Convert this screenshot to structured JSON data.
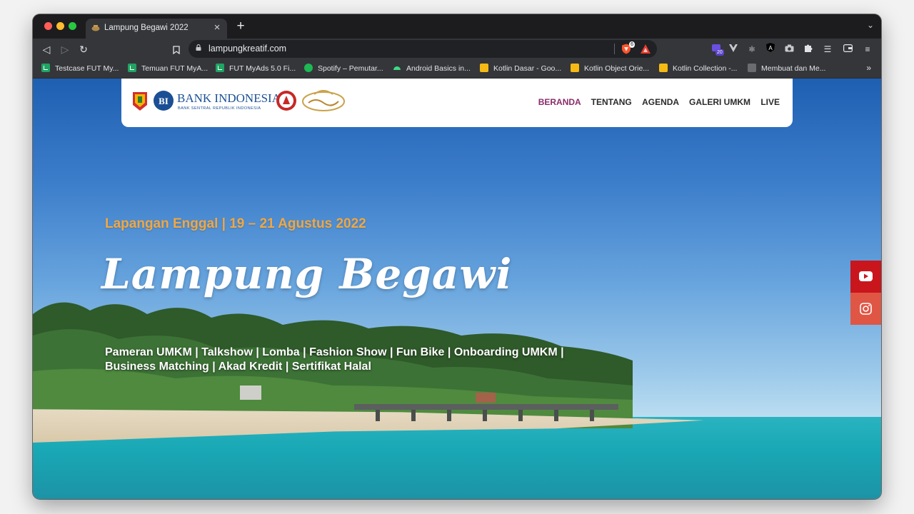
{
  "browser": {
    "tab": {
      "title": "Lampung Begawi 2022"
    },
    "url": "lampungkreatif.com",
    "shield_count": "6",
    "extension_badge": "20"
  },
  "bookmarks": [
    {
      "label": "Testcase FUT My...",
      "icon": "sheets-icon"
    },
    {
      "label": "Temuan FUT MyA...",
      "icon": "sheets-icon"
    },
    {
      "label": "FUT MyAds 5.0 Fi...",
      "icon": "sheets-icon"
    },
    {
      "label": "Spotify – Pemutar...",
      "icon": "spotify-icon"
    },
    {
      "label": "Android Basics in...",
      "icon": "android-icon"
    },
    {
      "label": "Kotlin Dasar - Goo...",
      "icon": "slides-icon"
    },
    {
      "label": "Kotlin Object Orie...",
      "icon": "slides-icon"
    },
    {
      "label": "Kotlin Collection -...",
      "icon": "slides-icon"
    },
    {
      "label": "Membuat dan Me...",
      "icon": "thumbnail-icon"
    }
  ],
  "site": {
    "logo": {
      "bank_name": "BANK INDONESIA",
      "bank_subtitle": "BANK SENTRAL REPUBLIK INDONESIA"
    },
    "nav": {
      "beranda": "BERANDA",
      "tentang": "TENTANG",
      "agenda": "AGENDA",
      "galeri": "GALERI UMKM",
      "live": "LIVE"
    },
    "hero": {
      "date_location": "Lapangan Enggal | 19 – 21 Agustus 2022",
      "title": "Lampung Begawi",
      "subtitle": "Pameran UMKM | Talkshow | Lomba | Fashion Show | Fun Bike | Onboarding UMKM | Business Matching | Akad Kredit | Sertifikat Halal"
    },
    "social": [
      {
        "name": "youtube-icon",
        "color": "#c9161c"
      },
      {
        "name": "instagram-icon",
        "color": "#e05645"
      }
    ],
    "accent": "#8a2c6b",
    "date_color": "#f0a742"
  }
}
